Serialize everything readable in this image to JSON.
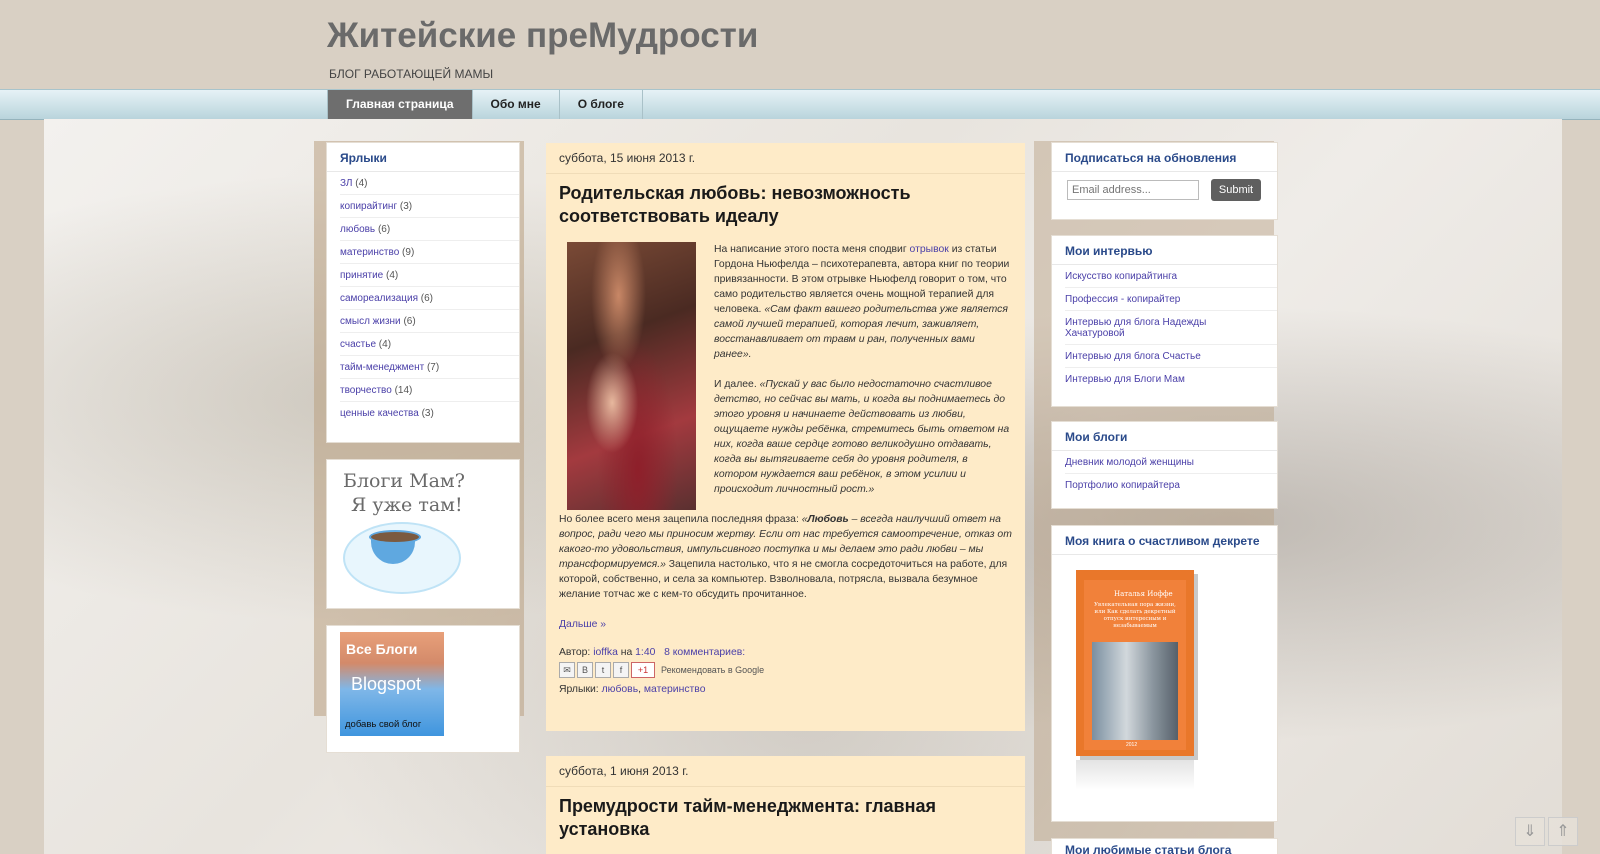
{
  "blog": {
    "title": "Житейские преМудрости",
    "description": "БЛОГ РАБОТАЮЩЕЙ МАМЫ"
  },
  "tabs": [
    {
      "label": "Главная страница",
      "active": true
    },
    {
      "label": "Обо мне",
      "active": false
    },
    {
      "label": "О блоге",
      "active": false
    }
  ],
  "labels_widget": {
    "title": "Ярлыки",
    "items": [
      {
        "name": "ЗЛ",
        "count": "(4)"
      },
      {
        "name": "копирайтинг",
        "count": "(3)"
      },
      {
        "name": "любовь",
        "count": "(6)"
      },
      {
        "name": "материнство",
        "count": "(9)"
      },
      {
        "name": "принятие",
        "count": "(4)"
      },
      {
        "name": "самореализация",
        "count": "(6)"
      },
      {
        "name": "смысл жизни",
        "count": "(6)"
      },
      {
        "name": "счастье",
        "count": "(4)"
      },
      {
        "name": "тайм-менеджмент",
        "count": "(7)"
      },
      {
        "name": "творчество",
        "count": "(14)"
      },
      {
        "name": "ценные качества",
        "count": "(3)"
      }
    ]
  },
  "blogmam_badge": {
    "line1": "Блоги Мам?",
    "line2": "Я уже там!"
  },
  "vseblogi_badge": {
    "line1": "Все Блоги",
    "line2": "Blogspot",
    "line3": "добавь свой блог"
  },
  "post1": {
    "date": "суббота, 15 июня 2013 г.",
    "title": "Родительская любовь: невозможность соответствовать идеалу",
    "p1_a": "На написание этого поста меня сподвиг ",
    "p1_link": "отрывок",
    "p1_b": " из статьи Гордона Ньюфелда – психотерапевта, автора книг по теории привязанности. В этом отрывке Ньюфелд говорит о том, что само родительство является очень мощной терапией для человека. ",
    "p1_quote": "«Сам факт вашего родительства уже является самой лучшей терапией, которая лечит, заживляет, восстанавливает от травм и ран, полученных вами ранее».",
    "p2_a": "И далее. ",
    "p2_quote": "«Пускай у вас было недостаточно счастливое детство, но сейчас вы мать, и когда вы поднимаетесь до этого уровня и начинаете действовать из любви, ощущаете нужды ребёнка, стремитесь быть ответом на них, когда ваше сердце готово великодушно отдавать, когда вы вытягиваете себя до уровня родителя, в котором нуждается ваш ребёнок, в этом усилии и происходит личностный рост.»",
    "p3_a": "Но более всего меня зацепила последняя фраза: ",
    "p3_q1": "«",
    "p3_bold": "Любовь",
    "p3_q2": " – всегда наилучший ответ на вопрос, ради чего мы приносим жертву. Если от нас требуется самоотречение, отказ от какого-то удовольствия, импульсивного поступка и мы делаем это ради любви – мы трансформируемся.»",
    "p3_b": " Зацепила настолько, что я не смогла сосредоточиться на работе, для которой, собственно, и села за компьютер. Взволновала, потрясла, вызвала безумное желание тотчас же с кем-то обсудить прочитанное.",
    "read_more": "Дальше »",
    "author_label": "Автор: ",
    "author": "ioffka",
    "at_label": " на ",
    "time": "1:40",
    "comments": "8 комментариев:",
    "gplus": "+1",
    "recommend": "Рекомендовать в Google",
    "labels_prefix": "Ярлыки: ",
    "label1": "любовь",
    "label_sep": ", ",
    "label2": "материнство"
  },
  "post2": {
    "date": "суббота, 1 июня 2013 г.",
    "title": "Премудрости тайм-менеджмента: главная установка"
  },
  "subscribe": {
    "title": "Подписаться на обновления",
    "placeholder": "Email address...",
    "submit": "Submit"
  },
  "interviews": {
    "title": "Мои интервью",
    "items": [
      "Искусство копирайтинга",
      "Профессия - копирайтер",
      "Интервью для блога Надежды Хачатуровой",
      "Интервью для блога Счастье",
      "Интервью для Блоги Мам"
    ]
  },
  "myblogs": {
    "title": "Мои блоги",
    "items": [
      "Дневник молодой женщины",
      "Портфолио копирайтера"
    ]
  },
  "book": {
    "title": "Моя книга о счастливом декрете",
    "cover_author": "Наталья Иоффе",
    "cover_title": "Увлекательная пора жизни, или Как сделать декретный отпуск интересным и незабываемым",
    "cover_year": "2012"
  },
  "favorites": {
    "title": "Мои любимые статьи блога"
  },
  "icons": {
    "scroll_down": "arrow-down-icon",
    "scroll_up": "arrow-up-icon"
  },
  "colors": {
    "accent_link": "#4a3fa8",
    "widget_title": "#2a4a8a",
    "post_bg": "#feebc8",
    "active_tab": "#6e6e6e"
  }
}
